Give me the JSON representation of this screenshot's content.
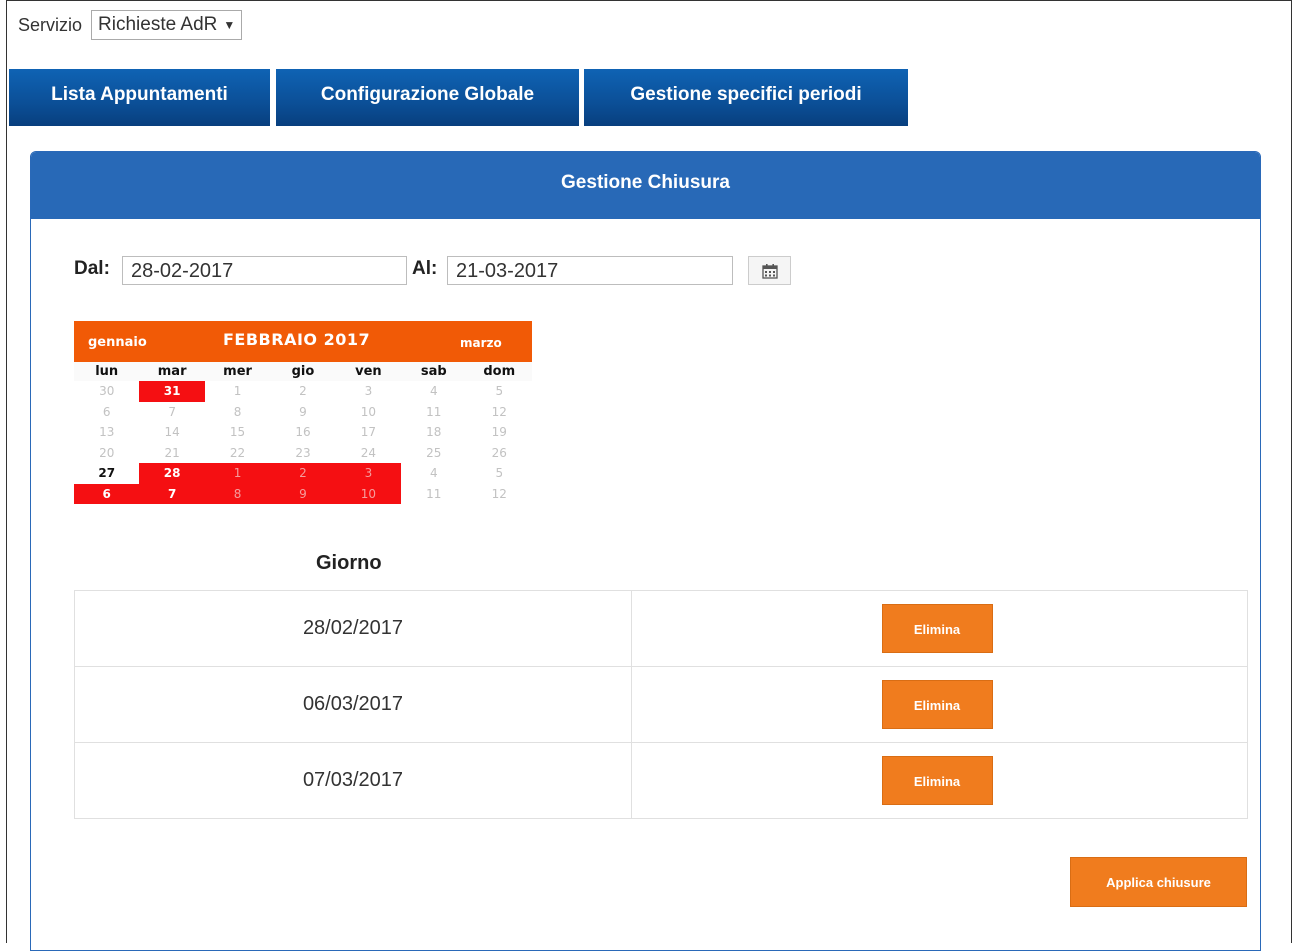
{
  "service": {
    "label": "Servizio",
    "selected": "Richieste AdR"
  },
  "tabs": [
    {
      "label": "Lista Appuntamenti"
    },
    {
      "label": "Configurazione Globale"
    },
    {
      "label": "Gestione specifici periodi"
    }
  ],
  "panel": {
    "title": "Gestione Chiusura"
  },
  "range": {
    "from_label": "Dal:",
    "from_value": "28-02-2017",
    "to_label": "Al:",
    "to_value": "21-03-2017",
    "calendar_icon": "calendar-icon"
  },
  "calendar": {
    "prev": "gennaio",
    "title": "FEBBRAIO 2017",
    "next": "marzo",
    "weekdays": [
      "lun",
      "mar",
      "mer",
      "gio",
      "ven",
      "sab",
      "dom"
    ],
    "weeks": [
      [
        {
          "d": "30"
        },
        {
          "d": "31",
          "s": "sel"
        },
        {
          "d": "1"
        },
        {
          "d": "2"
        },
        {
          "d": "3"
        },
        {
          "d": "4"
        },
        {
          "d": "5"
        }
      ],
      [
        {
          "d": "6"
        },
        {
          "d": "7"
        },
        {
          "d": "8"
        },
        {
          "d": "9"
        },
        {
          "d": "10"
        },
        {
          "d": "11"
        },
        {
          "d": "12"
        }
      ],
      [
        {
          "d": "13"
        },
        {
          "d": "14"
        },
        {
          "d": "15"
        },
        {
          "d": "16"
        },
        {
          "d": "17"
        },
        {
          "d": "18"
        },
        {
          "d": "19"
        }
      ],
      [
        {
          "d": "20"
        },
        {
          "d": "21"
        },
        {
          "d": "22"
        },
        {
          "d": "23"
        },
        {
          "d": "24"
        },
        {
          "d": "25"
        },
        {
          "d": "26"
        }
      ],
      [
        {
          "d": "27",
          "s": "bold"
        },
        {
          "d": "28",
          "s": "sel"
        },
        {
          "d": "1",
          "s": "sel dim"
        },
        {
          "d": "2",
          "s": "sel dim"
        },
        {
          "d": "3",
          "s": "sel dim"
        },
        {
          "d": "4"
        },
        {
          "d": "5"
        }
      ],
      [
        {
          "d": "6",
          "s": "sel"
        },
        {
          "d": "7",
          "s": "sel"
        },
        {
          "d": "8",
          "s": "sel dim"
        },
        {
          "d": "9",
          "s": "sel dim"
        },
        {
          "d": "10",
          "s": "sel dim"
        },
        {
          "d": "11"
        },
        {
          "d": "12"
        }
      ]
    ]
  },
  "days": {
    "header": "Giorno",
    "rows": [
      {
        "date": "28/02/2017",
        "action": "Elimina"
      },
      {
        "date": "06/03/2017",
        "action": "Elimina"
      },
      {
        "date": "07/03/2017",
        "action": "Elimina"
      }
    ]
  },
  "apply_label": "Applica chiusure",
  "colors": {
    "tab": "#0b4f97",
    "panel_header": "#2869b7",
    "calendar_header": "#f15a06",
    "selected_day": "#f50f12",
    "button": "#f07c1e"
  }
}
